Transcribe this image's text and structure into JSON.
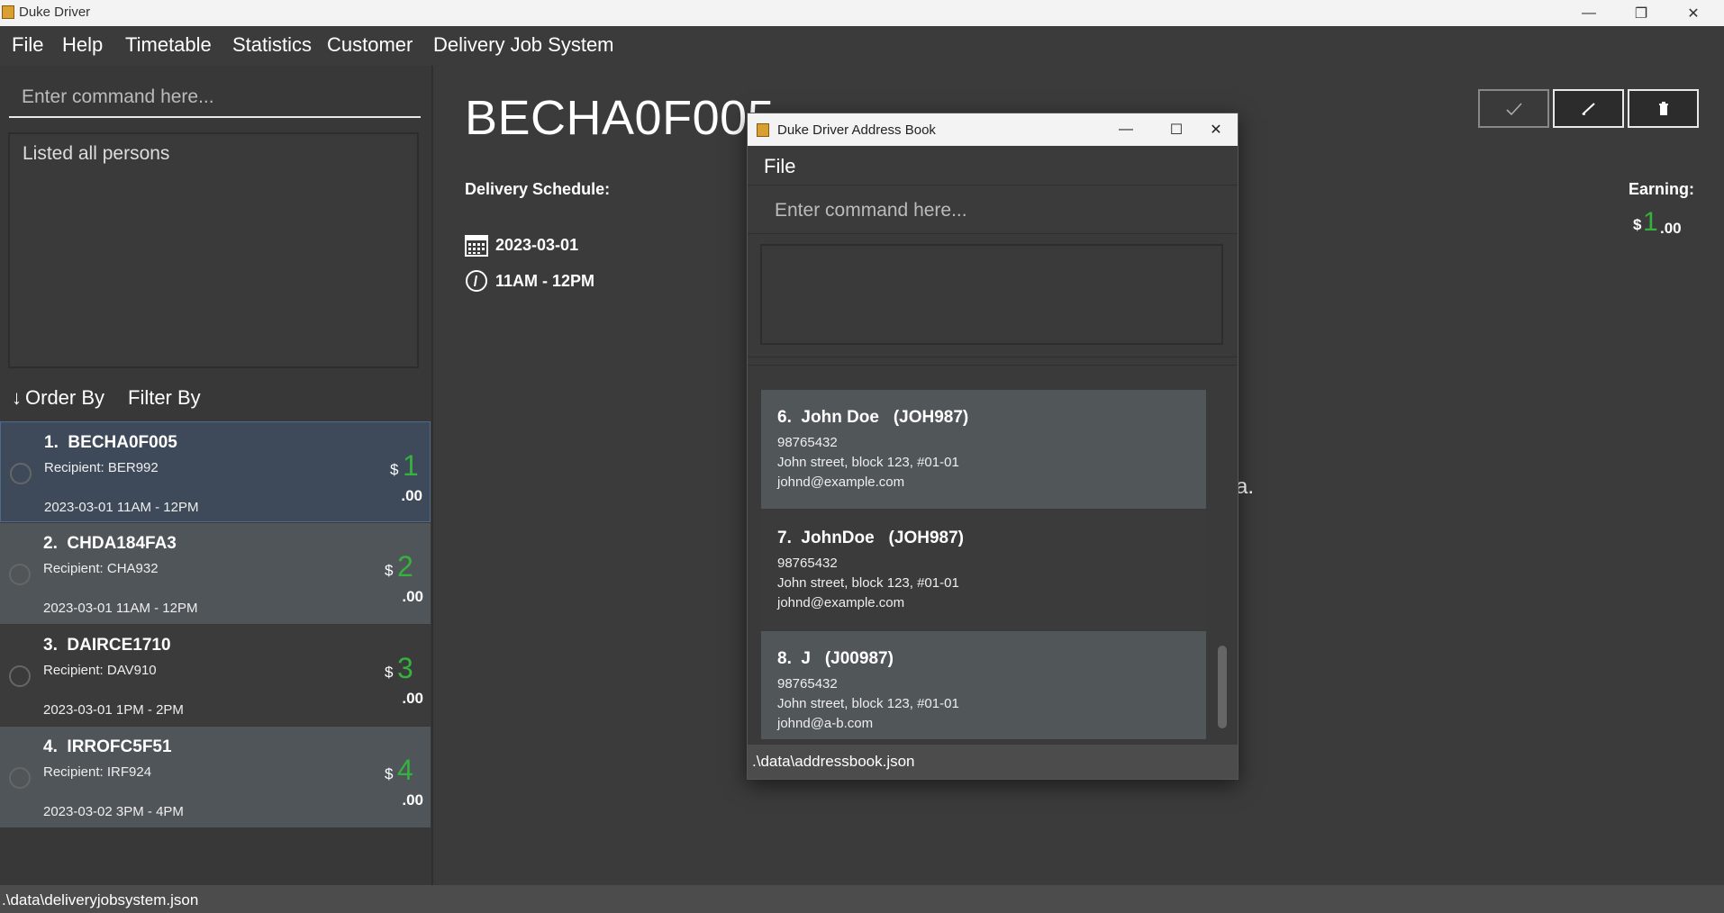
{
  "window": {
    "title": "Duke Driver",
    "controls": [
      "minimize-icon",
      "restore-icon",
      "close-icon"
    ]
  },
  "menu": {
    "items": [
      "File",
      "Help",
      "Timetable",
      "Statistics",
      "Customer",
      "Delivery Job System"
    ]
  },
  "command": {
    "placeholder": "Enter command here...",
    "result": "Listed all persons"
  },
  "list_controls": {
    "order_by": "Order By",
    "filter_by": "Filter By"
  },
  "jobs": [
    {
      "index": "1.",
      "id": "BECHA0F005",
      "recipient": "Recipient: BER992",
      "when": "2023-03-01 11AM - 12PM",
      "currency": "$",
      "amount": "1",
      "cents": ".00"
    },
    {
      "index": "2.",
      "id": "CHDA184FA3",
      "recipient": "Recipient: CHA932",
      "when": "2023-03-01 11AM - 12PM",
      "currency": "$",
      "amount": "2",
      "cents": ".00"
    },
    {
      "index": "3.",
      "id": "DAIRCE1710",
      "recipient": "Recipient: DAV910",
      "when": "2023-03-01 1PM  - 2PM",
      "currency": "$",
      "amount": "3",
      "cents": ".00"
    },
    {
      "index": "4.",
      "id": "IRROFC5F51",
      "recipient": "Recipient: IRF924",
      "when": "2023-03-02 3PM  - 4PM",
      "currency": "$",
      "amount": "4",
      "cents": ".00"
    }
  ],
  "detail": {
    "job_id": "BECHA0F005",
    "schedule_label": "Delivery Schedule:",
    "date": "2023-03-01",
    "time": "11AM - 12PM",
    "earning_label": "Earning:",
    "earning_currency": "$",
    "earning_amount": "1",
    "earning_cents": ".00",
    "partially_hidden_text": "a.",
    "actions": [
      "check-icon",
      "edit-icon",
      "delete-icon"
    ]
  },
  "status": {
    "path": ".\\data\\deliveryjobsystem.json"
  },
  "address_book": {
    "title": "Duke Driver Address Book",
    "menu_file": "File",
    "placeholder": "Enter command here...",
    "persons": [
      {
        "index": "6.",
        "name": "John Doe",
        "tag": "(JOH987)",
        "phone": "98765432",
        "address": "John street, block 123, #01-01",
        "email": "johnd@example.com"
      },
      {
        "index": "7.",
        "name": "JohnDoe",
        "tag": "(JOH987)",
        "phone": "98765432",
        "address": "John street, block 123, #01-01",
        "email": "johnd@example.com"
      },
      {
        "index": "8.",
        "name": "J",
        "tag": "(J00987)",
        "phone": "98765432",
        "address": "John street, block 123, #01-01",
        "email": "johnd@a-b.com"
      }
    ],
    "status_path": ".\\data\\addressbook.json"
  }
}
